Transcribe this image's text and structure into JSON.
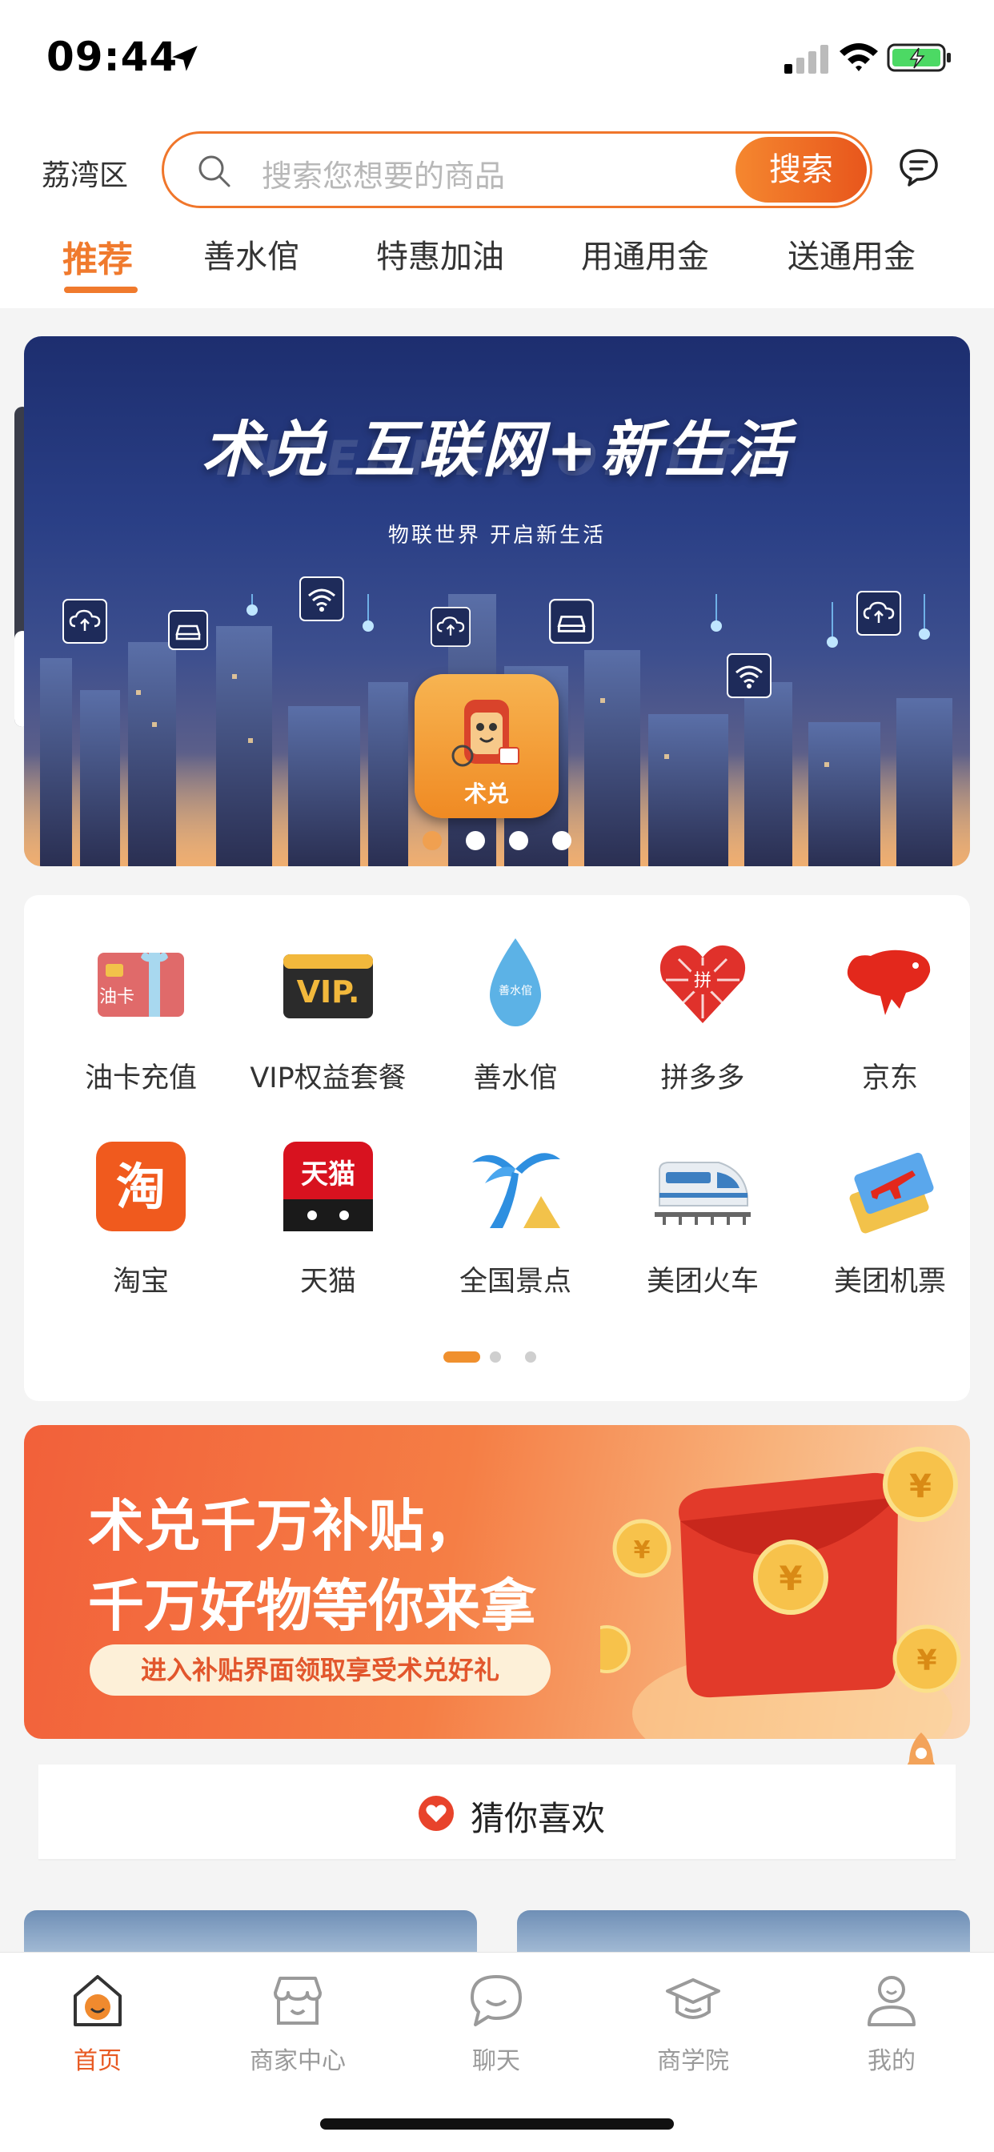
{
  "status_bar": {
    "time": "09:44"
  },
  "header": {
    "district": "荔湾区",
    "search_placeholder": "搜索您想要的商品",
    "search_button": "搜索",
    "tabs": [
      {
        "label": "推荐",
        "active": true
      },
      {
        "label": "善水倌"
      },
      {
        "label": "特惠加油"
      },
      {
        "label": "用通用金"
      },
      {
        "label": "送通用金"
      }
    ]
  },
  "banner": {
    "title": "术兑 互联网+新生活",
    "ghost_text": "INTERNET OF life",
    "subtitle": "物联世界  开启新生活",
    "badge_text": "术兑",
    "slide_count": 4,
    "active_slide": 1
  },
  "categories": {
    "items": [
      {
        "label": "油卡充值",
        "icon": "fuel-card-icon",
        "icon_text": "油卡"
      },
      {
        "label": "VIP权益套餐",
        "icon": "vip-icon",
        "icon_text": "VIP."
      },
      {
        "label": "善水倌",
        "icon": "water-drop-icon",
        "icon_text": "善水倌"
      },
      {
        "label": "拼多多",
        "icon": "pinduoduo-icon",
        "icon_text": "拼"
      },
      {
        "label": "京东",
        "icon": "jd-dog-icon"
      },
      {
        "label": "淘宝",
        "icon": "taobao-icon",
        "icon_text": "淘"
      },
      {
        "label": "天猫",
        "icon": "tmall-icon",
        "icon_text": "天猫"
      },
      {
        "label": "全国景点",
        "icon": "palm-tree-icon"
      },
      {
        "label": "美团火车",
        "icon": "train-icon"
      },
      {
        "label": "美团机票",
        "icon": "plane-ticket-icon"
      }
    ],
    "page_count": 3,
    "active_page": 1
  },
  "promo": {
    "line1": "术兑千万补贴，",
    "line2": "千万好物等你来拿",
    "pill": "进入补贴界面领取享受术兑好礼",
    "coin_symbol": "¥"
  },
  "guess": {
    "label": "猜你喜欢"
  },
  "tabbar": {
    "items": [
      {
        "label": "首页",
        "icon": "home-icon",
        "active": true
      },
      {
        "label": "商家中心",
        "icon": "shop-icon"
      },
      {
        "label": "聊天",
        "icon": "chat-icon"
      },
      {
        "label": "商学院",
        "icon": "graduation-cap-icon"
      },
      {
        "label": "我的",
        "icon": "profile-icon"
      }
    ]
  },
  "colors": {
    "accent": "#f07a2d",
    "tab_active": "#e85a23",
    "banner_bg": "#1d2e6f",
    "promo_bg": "#f2603a"
  }
}
